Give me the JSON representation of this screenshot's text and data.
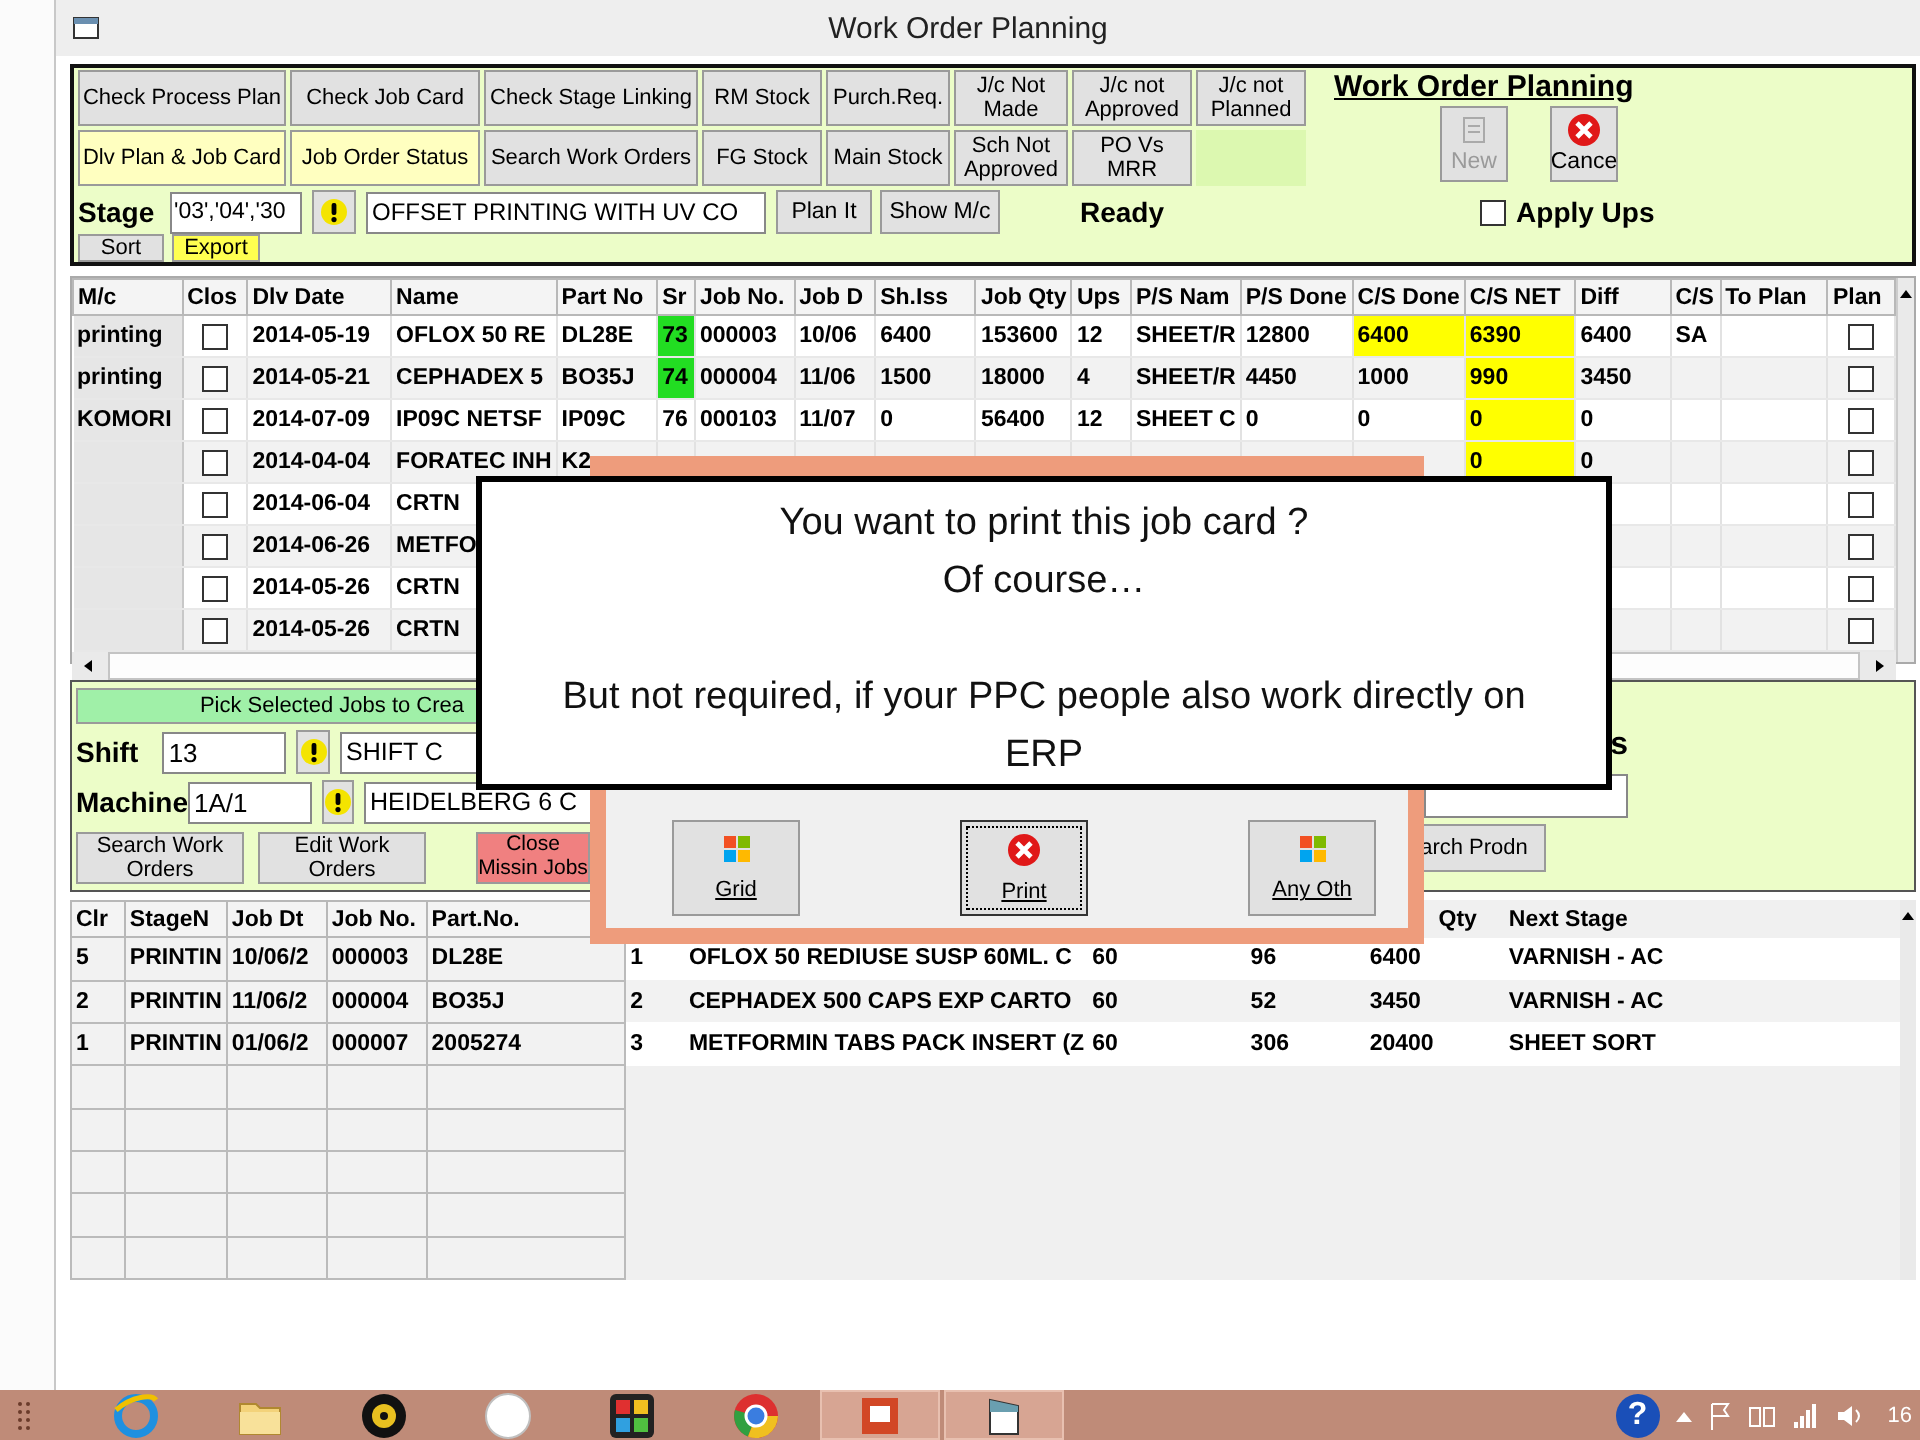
{
  "window": {
    "title": "Work Order Planning"
  },
  "toolbar": {
    "buttons": [
      {
        "label": "Check Process Plan",
        "highlighted": false
      },
      {
        "label": "Check Job Card",
        "highlighted": false
      },
      {
        "label": "Check Stage Linking",
        "highlighted": false
      },
      {
        "label": "RM Stock",
        "highlighted": false
      },
      {
        "label": "Purch.Req.",
        "highlighted": false
      },
      {
        "label": "J/c Not Made",
        "highlighted": false
      },
      {
        "label": "J/c not Approved",
        "highlighted": false
      },
      {
        "label": "J/c not Planned",
        "highlighted": false
      },
      {
        "label": "Dlv Plan & Job Card",
        "highlighted": true
      },
      {
        "label": "Job Order Status",
        "highlighted": true
      },
      {
        "label": "Search Work Orders",
        "highlighted": false
      },
      {
        "label": "FG Stock",
        "highlighted": false
      },
      {
        "label": "Main Stock",
        "highlighted": false
      },
      {
        "label": "Sch Not Approved",
        "highlighted": false
      },
      {
        "label": "PO Vs MRR",
        "highlighted": false
      }
    ]
  },
  "heading": "Work Order Planning",
  "actions": [
    {
      "label": "New",
      "kind": "new",
      "disabled": true
    },
    {
      "label": "Cance",
      "kind": "cancel",
      "disabled": false
    }
  ],
  "stage": {
    "label": "Stage",
    "code": "'03','04','30",
    "description": "OFFSET PRINTING WITH UV CO"
  },
  "stage_buttons": [
    "Plan It",
    "Show M/c"
  ],
  "status": "Ready",
  "apply_ups": {
    "label": "Apply Ups",
    "checked": false
  },
  "sort_button": "Sort",
  "export_button": "Export",
  "planning_grid": {
    "columns": [
      {
        "label": "M/c",
        "kind": "label"
      },
      {
        "label": "Clos",
        "kind": "check"
      },
      {
        "label": "Dlv Date",
        "kind": "text"
      },
      {
        "label": "Name",
        "kind": "text"
      },
      {
        "label": "Part No",
        "kind": "text"
      },
      {
        "label": "Sr",
        "kind": "text"
      },
      {
        "label": "Job No.",
        "kind": "text"
      },
      {
        "label": "Job D",
        "kind": "text"
      },
      {
        "label": "Sh.Iss",
        "kind": "text"
      },
      {
        "label": "Job Qty",
        "kind": "text"
      },
      {
        "label": "Ups",
        "kind": "text"
      },
      {
        "label": "P/S Nam",
        "kind": "text"
      },
      {
        "label": "P/S Done",
        "kind": "text"
      },
      {
        "label": "C/S Done",
        "kind": "text"
      },
      {
        "label": "C/S NET",
        "kind": "text"
      },
      {
        "label": "Diff",
        "kind": "text"
      },
      {
        "label": "C/S",
        "kind": "text"
      },
      {
        "label": "To Plan",
        "kind": "text"
      },
      {
        "label": "Plan",
        "kind": "check"
      }
    ],
    "rows": [
      {
        "cells": [
          "printing",
          {
            "checked": false
          },
          "2014-05-19",
          "OFLOX 50 RE",
          "DL28E",
          {
            "text": "73",
            "color": "#22dd22"
          },
          "000003",
          "10/06",
          "6400",
          "153600",
          "12",
          "SHEET/R",
          "12800",
          {
            "text": "6400",
            "color": "#ffff00"
          },
          {
            "text": "6390",
            "color": "#ffff00"
          },
          "6400",
          "SA",
          null,
          {
            "checked": false
          }
        ]
      },
      {
        "cells": [
          "printing",
          {
            "checked": false
          },
          "2014-05-21",
          "CEPHADEX 5",
          "BO35J",
          {
            "text": "74",
            "color": "#22dd22"
          },
          "000004",
          "11/06",
          "1500",
          "18000",
          "4",
          "SHEET/R",
          "4450",
          "1000",
          {
            "text": "990",
            "color": "#ffff00"
          },
          "3450",
          null,
          null,
          {
            "checked": false
          }
        ]
      },
      {
        "cells": [
          "KOMORI",
          {
            "checked": false
          },
          "2014-07-09",
          "IP09C NETSF",
          "IP09C",
          "76",
          "000103",
          "11/07",
          "0",
          "56400",
          "12",
          "SHEET C",
          "0",
          "0",
          {
            "text": "0",
            "color": "#ffff00"
          },
          "0",
          null,
          null,
          {
            "checked": false
          }
        ]
      },
      {
        "cells": [
          null,
          {
            "checked": false
          },
          "2014-04-04",
          "FORATEC INH",
          "K2",
          null,
          null,
          null,
          null,
          null,
          null,
          null,
          null,
          null,
          {
            "text": "0",
            "color": "#ffff00"
          },
          "0",
          null,
          null,
          {
            "checked": false
          }
        ]
      },
      {
        "cells": [
          null,
          {
            "checked": false
          },
          "2014-06-04",
          "CRTN",
          null,
          null,
          null,
          null,
          null,
          null,
          null,
          null,
          null,
          null,
          null,
          null,
          null,
          null,
          {
            "checked": false
          }
        ]
      },
      {
        "cells": [
          null,
          {
            "checked": false
          },
          "2014-06-26",
          "METFO",
          null,
          null,
          null,
          null,
          null,
          null,
          null,
          null,
          null,
          null,
          null,
          null,
          null,
          null,
          {
            "checked": false
          }
        ]
      },
      {
        "cells": [
          null,
          {
            "checked": false
          },
          "2014-05-26",
          "CRTN",
          null,
          null,
          null,
          null,
          null,
          null,
          null,
          null,
          null,
          null,
          null,
          null,
          null,
          null,
          {
            "checked": false
          }
        ]
      },
      {
        "cells": [
          null,
          {
            "checked": false
          },
          "2014-05-26",
          "CRTN",
          null,
          null,
          null,
          null,
          null,
          null,
          null,
          null,
          null,
          null,
          null,
          null,
          null,
          null,
          {
            "checked": false
          }
        ]
      }
    ]
  },
  "scheduling": {
    "pick_button": "Pick Selected Jobs to Crea",
    "shift": {
      "label": "Shift",
      "code": "13",
      "name": "SHIFT C"
    },
    "machine": {
      "label": "Machine",
      "code": "1A/1",
      "name": "HEIDELBERG 6 C"
    },
    "buttons": [
      {
        "label": "Search Work Orders",
        "kind": "normal"
      },
      {
        "label": "Edit Work Orders",
        "kind": "normal"
      },
      {
        "label": "Close Missin Jobs",
        "kind": "alert"
      }
    ],
    "side_label": "s",
    "search_prodn_button": "arch Prodn"
  },
  "jobs_grid": {
    "columns": [
      "Clr",
      "StageN",
      "Job Dt",
      "Job No.",
      "Part.No.",
      null,
      null,
      null,
      null,
      "Qty",
      "Next Stage",
      null
    ],
    "rows": [
      {
        "cells": [
          "5",
          "PRINTIN",
          "10/06/2",
          "000003",
          "DL28E",
          "1",
          "OFLOX 50 REDIUSE SUSP 60ML. C",
          "60",
          "96",
          "6400",
          "VARNISH - AC",
          null
        ]
      },
      {
        "cells": [
          "2",
          "PRINTIN",
          "11/06/2",
          "000004",
          "BO35J",
          "2",
          "CEPHADEX 500 CAPS EXP CARTO",
          "60",
          "52",
          "3450",
          "VARNISH - AC",
          null
        ]
      },
      {
        "cells": [
          "1",
          "PRINTIN",
          "01/06/2",
          "000007",
          "2005274",
          "3",
          "METFORMIN TABS PACK INSERT (Z",
          "60",
          "306",
          "20400",
          "SHEET SORT",
          null
        ]
      }
    ]
  },
  "dialog": {
    "buttons": [
      {
        "label": "Grid",
        "kind": "app",
        "focused": false
      },
      {
        "label": "Print",
        "kind": "stop",
        "focused": true
      },
      {
        "label": "Any Oth",
        "kind": "app",
        "focused": false
      }
    ]
  },
  "callout": {
    "question": "You want to print this job card ?",
    "answer": "Of course…",
    "note": "But not required, if your PPC people also work directly on ERP"
  },
  "taskbar": {
    "apps": [
      {
        "kind": "browser",
        "active": false
      },
      {
        "kind": "folder",
        "active": false
      },
      {
        "kind": "disc",
        "active": false
      },
      {
        "kind": "logo",
        "active": false
      },
      {
        "kind": "puzzle",
        "active": false
      },
      {
        "kind": "wheel",
        "active": false
      },
      {
        "kind": "slides",
        "active": true
      },
      {
        "kind": "window",
        "active": true
      }
    ],
    "help_glyph": "?",
    "clock": "16"
  }
}
